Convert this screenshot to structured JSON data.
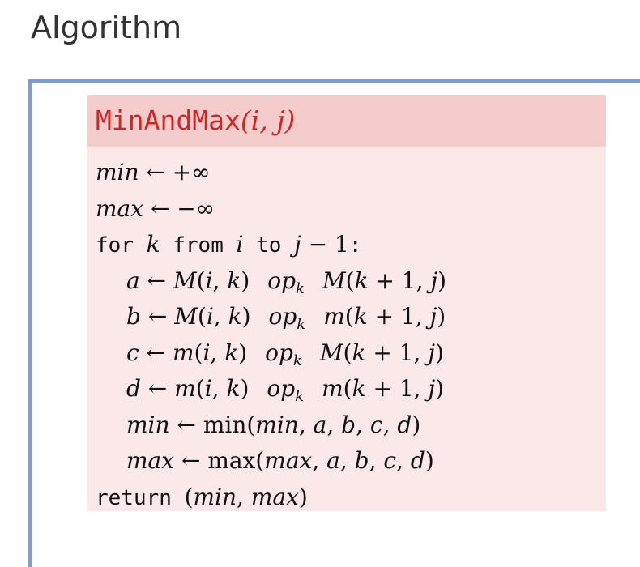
{
  "heading": "Algorithm",
  "algorithm": {
    "name": "MinAndMax",
    "params": "(i, j)",
    "lines": [
      {
        "id": "line-min-init",
        "indent": 0,
        "parts": [
          {
            "t": "min",
            "s": "it"
          },
          {
            "t": " ← +∞",
            "s": "serif"
          }
        ]
      },
      {
        "id": "line-max-init",
        "indent": 0,
        "parts": [
          {
            "t": "max",
            "s": "it"
          },
          {
            "t": " ← −∞",
            "s": "serif"
          }
        ]
      },
      {
        "id": "line-for-loop",
        "indent": 0,
        "parts": [
          {
            "t": "for ",
            "s": "mono"
          },
          {
            "t": "k",
            "s": "it"
          },
          {
            "t": " from ",
            "s": "mono"
          },
          {
            "t": "i",
            "s": "it"
          },
          {
            "t": " to ",
            "s": "mono"
          },
          {
            "t": "j",
            "s": "it"
          },
          {
            "t": " − 1",
            "s": "serif"
          },
          {
            "t": ":",
            "s": "mono"
          }
        ]
      },
      {
        "id": "line-a",
        "indent": 1,
        "parts": [
          {
            "t": "a",
            "s": "it"
          },
          {
            "t": " ← ",
            "s": "serif"
          },
          {
            "t": "M",
            "s": "it"
          },
          {
            "t": "(",
            "s": "serif"
          },
          {
            "t": "i",
            "s": "it"
          },
          {
            "t": ", ",
            "s": "serif"
          },
          {
            "t": "k",
            "s": "it"
          },
          {
            "t": ")",
            "s": "serif"
          },
          {
            "t": "",
            "s": "gap"
          },
          {
            "t": "op",
            "s": "it"
          },
          {
            "t": "k",
            "s": "sub"
          },
          {
            "t": "",
            "s": "gap"
          },
          {
            "t": "M",
            "s": "it"
          },
          {
            "t": "(",
            "s": "serif"
          },
          {
            "t": "k",
            "s": "it"
          },
          {
            "t": " + 1, ",
            "s": "serif"
          },
          {
            "t": "j",
            "s": "it"
          },
          {
            "t": ")",
            "s": "serif"
          }
        ]
      },
      {
        "id": "line-b",
        "indent": 1,
        "parts": [
          {
            "t": "b",
            "s": "it"
          },
          {
            "t": " ← ",
            "s": "serif"
          },
          {
            "t": "M",
            "s": "it"
          },
          {
            "t": "(",
            "s": "serif"
          },
          {
            "t": "i",
            "s": "it"
          },
          {
            "t": ", ",
            "s": "serif"
          },
          {
            "t": "k",
            "s": "it"
          },
          {
            "t": ")",
            "s": "serif"
          },
          {
            "t": "",
            "s": "gap"
          },
          {
            "t": "op",
            "s": "it"
          },
          {
            "t": "k",
            "s": "sub"
          },
          {
            "t": "",
            "s": "gap"
          },
          {
            "t": "m",
            "s": "it"
          },
          {
            "t": "(",
            "s": "serif"
          },
          {
            "t": "k",
            "s": "it"
          },
          {
            "t": " + 1, ",
            "s": "serif"
          },
          {
            "t": "j",
            "s": "it"
          },
          {
            "t": ")",
            "s": "serif"
          }
        ]
      },
      {
        "id": "line-c",
        "indent": 1,
        "parts": [
          {
            "t": "c",
            "s": "it"
          },
          {
            "t": " ← ",
            "s": "serif"
          },
          {
            "t": "m",
            "s": "it"
          },
          {
            "t": "(",
            "s": "serif"
          },
          {
            "t": "i",
            "s": "it"
          },
          {
            "t": ", ",
            "s": "serif"
          },
          {
            "t": "k",
            "s": "it"
          },
          {
            "t": ")",
            "s": "serif"
          },
          {
            "t": "",
            "s": "gap"
          },
          {
            "t": "op",
            "s": "it"
          },
          {
            "t": "k",
            "s": "sub"
          },
          {
            "t": "",
            "s": "gap"
          },
          {
            "t": "M",
            "s": "it"
          },
          {
            "t": "(",
            "s": "serif"
          },
          {
            "t": "k",
            "s": "it"
          },
          {
            "t": " + 1, ",
            "s": "serif"
          },
          {
            "t": "j",
            "s": "it"
          },
          {
            "t": ")",
            "s": "serif"
          }
        ]
      },
      {
        "id": "line-d",
        "indent": 1,
        "parts": [
          {
            "t": "d",
            "s": "it"
          },
          {
            "t": " ← ",
            "s": "serif"
          },
          {
            "t": "m",
            "s": "it"
          },
          {
            "t": "(",
            "s": "serif"
          },
          {
            "t": "i",
            "s": "it"
          },
          {
            "t": ", ",
            "s": "serif"
          },
          {
            "t": "k",
            "s": "it"
          },
          {
            "t": ")",
            "s": "serif"
          },
          {
            "t": "",
            "s": "gap"
          },
          {
            "t": "op",
            "s": "it"
          },
          {
            "t": "k",
            "s": "sub"
          },
          {
            "t": "",
            "s": "gap"
          },
          {
            "t": "m",
            "s": "it"
          },
          {
            "t": "(",
            "s": "serif"
          },
          {
            "t": "k",
            "s": "it"
          },
          {
            "t": " + 1, ",
            "s": "serif"
          },
          {
            "t": "j",
            "s": "it"
          },
          {
            "t": ")",
            "s": "serif"
          }
        ]
      },
      {
        "id": "line-min-update",
        "indent": 1,
        "parts": [
          {
            "t": "min",
            "s": "it"
          },
          {
            "t": " ← ",
            "s": "serif"
          },
          {
            "t": "min(",
            "s": "plain"
          },
          {
            "t": "min",
            "s": "it"
          },
          {
            "t": ", ",
            "s": "serif"
          },
          {
            "t": "a",
            "s": "it"
          },
          {
            "t": ", ",
            "s": "serif"
          },
          {
            "t": "b",
            "s": "it"
          },
          {
            "t": ", ",
            "s": "serif"
          },
          {
            "t": "c",
            "s": "it"
          },
          {
            "t": ", ",
            "s": "serif"
          },
          {
            "t": "d",
            "s": "it"
          },
          {
            "t": ")",
            "s": "serif"
          }
        ]
      },
      {
        "id": "line-max-update",
        "indent": 1,
        "parts": [
          {
            "t": "max",
            "s": "it"
          },
          {
            "t": " ← ",
            "s": "serif"
          },
          {
            "t": "max(",
            "s": "plain"
          },
          {
            "t": "max",
            "s": "it"
          },
          {
            "t": ", ",
            "s": "serif"
          },
          {
            "t": "a",
            "s": "it"
          },
          {
            "t": ", ",
            "s": "serif"
          },
          {
            "t": "b",
            "s": "it"
          },
          {
            "t": ", ",
            "s": "serif"
          },
          {
            "t": "c",
            "s": "it"
          },
          {
            "t": ", ",
            "s": "serif"
          },
          {
            "t": "d",
            "s": "it"
          },
          {
            "t": ")",
            "s": "serif"
          }
        ]
      },
      {
        "id": "line-return",
        "indent": 0,
        "parts": [
          {
            "t": "return ",
            "s": "mono"
          },
          {
            "t": "(",
            "s": "serif"
          },
          {
            "t": "min",
            "s": "it"
          },
          {
            "t": ", ",
            "s": "serif"
          },
          {
            "t": "max",
            "s": "it"
          },
          {
            "t": ")",
            "s": "serif"
          }
        ]
      }
    ]
  },
  "colors": {
    "title_text": "#d42525",
    "title_bar": "#f5cccc",
    "block_body": "#fbe8e8",
    "frame_border": "#7a9bd4"
  }
}
